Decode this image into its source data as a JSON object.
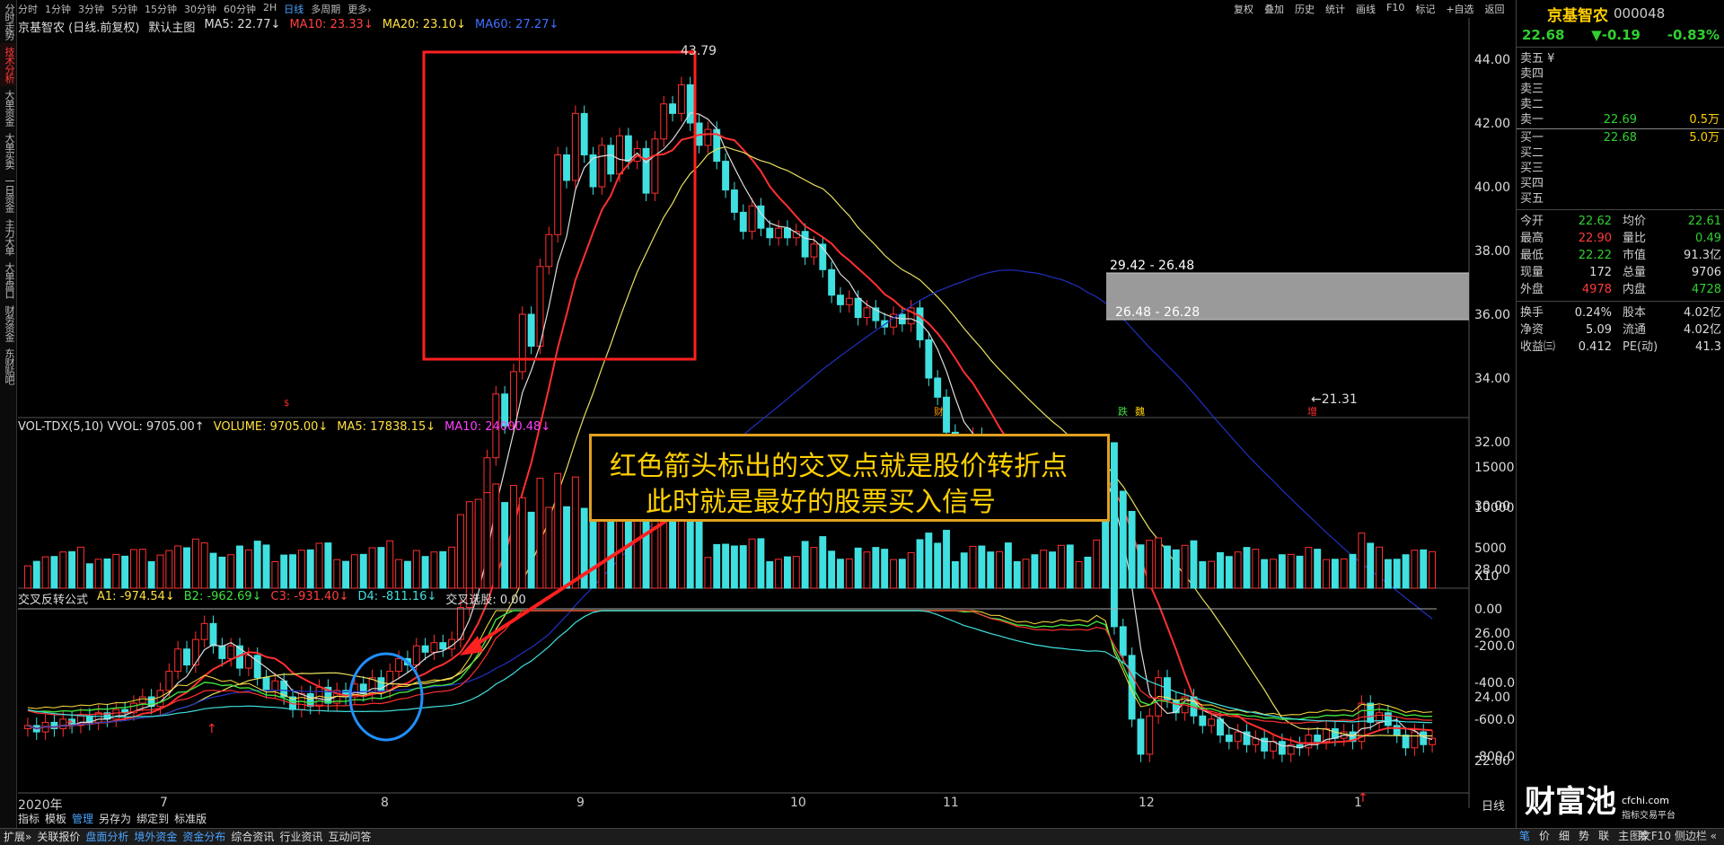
{
  "left_tabs": [
    "分时走势",
    "技术分析",
    "大单资金",
    "大单买卖",
    "一日资金",
    "主力大单",
    "大单盘口",
    "财务资金",
    "东财贴吧"
  ],
  "left_tabs_active": 1,
  "periods": [
    "分时",
    "1分钟",
    "3分钟",
    "5分钟",
    "15分钟",
    "30分钟",
    "60分钟",
    "2H",
    "日线",
    "多周期",
    "更多›"
  ],
  "periods_active": 8,
  "toolbar": [
    "复权",
    "叠加",
    "历史",
    "统计",
    "画线",
    "F10",
    "标记",
    "+自选",
    "返回"
  ],
  "main_legend": {
    "title": "京基智农 (日线.前复权)",
    "main_icon": "默认主图",
    "ma5": "MA5: 22.77↓",
    "ma10": "MA10: 23.33↓",
    "ma20": "MA20: 23.10↓",
    "ma60": "MA60: 27.27↓"
  },
  "vol_legend": {
    "title": "VOL-TDX(5,10) VVOL: 9705.00↑",
    "volume": "VOLUME: 9705.00↓",
    "ma5": "MA5: 17838.15↓",
    "ma10": "MA10: 24000.48↓"
  },
  "ind_legend": {
    "title": "交叉反转公式",
    "a1": "A1: -974.54↓",
    "b2": "B2: -962.69↓",
    "c3": "C3: -931.40↓",
    "d4": "D4: -811.16↓",
    "sel": "交叉选股: 0.00"
  },
  "price_axis": [
    "44.00",
    "42.00",
    "40.00",
    "38.00",
    "36.00",
    "34.00",
    "32.00",
    "30.00",
    "28.00",
    "26.00",
    "24.00",
    "22.00"
  ],
  "vol_axis": [
    "15000",
    "10000",
    "5000",
    "X10"
  ],
  "ind_axis": [
    "0.00",
    "-200.0",
    "-400.0",
    "-600.0",
    "-800.0"
  ],
  "x_labels": [
    "2020年",
    "7",
    "8",
    "9",
    "10",
    "11",
    "12",
    "1"
  ],
  "day_label": "日线",
  "chart_annotations": {
    "high": "43.79",
    "low": "←21.31",
    "gap_upper": "29.42 - 26.48",
    "gap_lower": "26.48 - 26.28",
    "events": [
      "财",
      "跌",
      "魏",
      "增",
      "$"
    ]
  },
  "note": {
    "line1": "红色箭头标出的交叉点就是股价转折点",
    "line2": "此时就是最好的股票买入信号"
  },
  "quote": {
    "name": "京基智农",
    "code": "000048",
    "price": "22.68",
    "change": "▼-0.19",
    "pct": "-0.83%",
    "asks": [
      {
        "label": "卖五 ¥",
        "price": "",
        "size": ""
      },
      {
        "label": "卖四",
        "price": "",
        "size": ""
      },
      {
        "label": "卖三",
        "price": "",
        "size": ""
      },
      {
        "label": "卖二",
        "price": "",
        "size": ""
      },
      {
        "label": "卖一",
        "price": "22.69",
        "size": "0.5万"
      }
    ],
    "bids": [
      {
        "label": "买一",
        "price": "22.68",
        "size": "5.0万"
      },
      {
        "label": "买二",
        "price": "",
        "size": ""
      },
      {
        "label": "买三",
        "price": "",
        "size": ""
      },
      {
        "label": "买四",
        "price": "",
        "size": ""
      },
      {
        "label": "买五",
        "price": "",
        "size": ""
      }
    ],
    "stats": [
      {
        "l1": "今开",
        "v1": "22.62",
        "c1": "g",
        "l2": "均价",
        "v2": "22.61",
        "c2": "g"
      },
      {
        "l1": "最高",
        "v1": "22.90",
        "c1": "r",
        "l2": "量比",
        "v2": "0.49",
        "c2": "g"
      },
      {
        "l1": "最低",
        "v1": "22.22",
        "c1": "g",
        "l2": "市值",
        "v2": "91.3亿",
        "c2": "w"
      },
      {
        "l1": "现量",
        "v1": "172",
        "c1": "w",
        "l2": "总量",
        "v2": "9706",
        "c2": "w"
      },
      {
        "l1": "外盘",
        "v1": "4978",
        "c1": "r",
        "l2": "内盘",
        "v2": "4728",
        "c2": "g"
      }
    ],
    "stats2": [
      {
        "l1": "换手",
        "v1": "0.24%",
        "c1": "w",
        "l2": "股本",
        "v2": "4.02亿",
        "c2": "w"
      },
      {
        "l1": "净资",
        "v1": "5.09",
        "c1": "w",
        "l2": "流通",
        "v2": "4.02亿",
        "c2": "w"
      },
      {
        "l1": "收益㈢",
        "v1": "0.412",
        "c1": "w",
        "l2": "PE(动)",
        "v2": "41.3",
        "c2": "w"
      }
    ]
  },
  "brand": {
    "big": "财富池",
    "site": "cfchi.com",
    "sub": "指标交易平台"
  },
  "bottom_tabs": [
    "指标",
    "模板",
    "管理",
    "另存为",
    "绑定到",
    "标准版"
  ],
  "bottom_tabs_active": 2,
  "status": [
    "扩展»",
    "关联报价",
    "盘面分析",
    "境外资金",
    "资金分布",
    "综合资讯",
    "行业资讯",
    "互动问答"
  ],
  "status_right": "图文F10 侧边栏 «",
  "right_letters": [
    "笔",
    "价",
    "细",
    "势",
    "联",
    "主",
    "筹"
  ],
  "colors": {
    "ma5": "#dddddd",
    "ma10": "#ff3030",
    "ma20": "#e8e060",
    "ma60": "#2030c0",
    "up": "#ff3030",
    "down": "#40e0e0",
    "box": "#ff2020",
    "circle": "#2090ff"
  },
  "chart_data": {
    "type": "candlestick",
    "candles": [
      [
        23.0,
        23.1
      ],
      [
        23.1,
        22.9
      ],
      [
        22.9,
        23.2
      ],
      [
        23.2,
        23.0
      ],
      [
        23.0,
        23.3
      ],
      [
        23.3,
        23.1
      ],
      [
        23.1,
        23.4
      ],
      [
        23.4,
        23.2
      ],
      [
        23.2,
        23.5
      ],
      [
        23.5,
        23.3
      ],
      [
        23.3,
        23.6
      ],
      [
        23.6,
        23.5
      ],
      [
        23.5,
        23.8
      ],
      [
        23.8,
        24.0
      ],
      [
        24.0,
        23.7
      ],
      [
        23.7,
        24.2
      ],
      [
        24.2,
        24.8
      ],
      [
        24.8,
        25.5
      ],
      [
        25.5,
        25.0
      ],
      [
        25.0,
        25.8
      ],
      [
        25.8,
        26.3
      ],
      [
        26.3,
        25.6
      ],
      [
        25.6,
        25.2
      ],
      [
        25.2,
        25.6
      ],
      [
        25.6,
        24.9
      ],
      [
        24.9,
        25.3
      ],
      [
        25.3,
        24.6
      ],
      [
        24.6,
        24.2
      ],
      [
        24.2,
        24.5
      ],
      [
        24.5,
        24.0
      ],
      [
        24.0,
        23.6
      ],
      [
        23.6,
        24.1
      ],
      [
        24.1,
        23.7
      ],
      [
        23.7,
        24.3
      ],
      [
        24.3,
        23.8
      ],
      [
        23.8,
        24.2
      ],
      [
        24.2,
        24.0
      ],
      [
        24.0,
        24.4
      ],
      [
        24.4,
        24.1
      ],
      [
        24.1,
        24.6
      ],
      [
        24.6,
        24.2
      ],
      [
        24.2,
        24.8
      ],
      [
        24.8,
        25.2
      ],
      [
        25.2,
        25.0
      ],
      [
        25.0,
        25.6
      ],
      [
        25.6,
        25.4
      ],
      [
        25.4,
        25.7
      ],
      [
        25.7,
        25.5
      ],
      [
        25.5,
        25.8
      ],
      [
        25.8,
        26.8
      ],
      [
        26.8,
        28.3
      ],
      [
        28.3,
        29.8
      ],
      [
        29.8,
        31.5
      ],
      [
        31.5,
        33.5
      ],
      [
        33.5,
        32.5
      ],
      [
        32.5,
        34.2
      ],
      [
        34.2,
        36.0
      ],
      [
        36.0,
        35.0
      ],
      [
        35.0,
        37.5
      ],
      [
        37.5,
        38.5
      ],
      [
        38.5,
        41.0
      ],
      [
        41.0,
        40.2
      ],
      [
        40.2,
        42.3
      ],
      [
        42.3,
        41.0
      ],
      [
        41.0,
        40.0
      ],
      [
        40.0,
        41.3
      ],
      [
        41.3,
        40.4
      ],
      [
        40.4,
        41.6
      ],
      [
        41.6,
        40.8
      ],
      [
        40.8,
        41.2
      ],
      [
        41.2,
        39.8
      ],
      [
        39.8,
        41.5
      ],
      [
        41.5,
        42.6
      ],
      [
        42.6,
        42.3
      ],
      [
        42.3,
        43.2
      ],
      [
        43.2,
        42.0
      ],
      [
        42.0,
        41.3
      ],
      [
        41.3,
        41.8
      ],
      [
        41.8,
        40.8
      ],
      [
        40.8,
        39.9
      ],
      [
        39.9,
        39.2
      ],
      [
        39.2,
        38.6
      ],
      [
        38.6,
        39.4
      ],
      [
        39.4,
        38.7
      ],
      [
        38.7,
        38.4
      ],
      [
        38.4,
        38.7
      ],
      [
        38.7,
        38.4
      ],
      [
        38.4,
        38.6
      ],
      [
        38.6,
        37.8
      ],
      [
        37.8,
        38.2
      ],
      [
        38.2,
        37.4
      ],
      [
        37.4,
        36.6
      ],
      [
        36.6,
        36.3
      ],
      [
        36.3,
        36.5
      ],
      [
        36.5,
        35.9
      ],
      [
        35.9,
        36.2
      ],
      [
        36.2,
        35.8
      ],
      [
        35.8,
        35.6
      ],
      [
        35.6,
        36.0
      ],
      [
        36.0,
        35.7
      ],
      [
        35.7,
        36.2
      ],
      [
        36.2,
        35.2
      ],
      [
        35.2,
        34.0
      ],
      [
        34.0,
        33.4
      ],
      [
        33.4,
        32.3
      ],
      [
        32.3,
        32.0
      ],
      [
        32.0,
        31.4
      ],
      [
        31.4,
        32.2
      ],
      [
        32.2,
        31.5
      ],
      [
        31.5,
        31.2
      ],
      [
        31.2,
        31.4
      ],
      [
        31.4,
        30.9
      ],
      [
        30.9,
        30.6
      ],
      [
        30.6,
        30.9
      ],
      [
        30.9,
        30.5
      ],
      [
        30.5,
        31.0
      ],
      [
        31.0,
        30.7
      ],
      [
        30.7,
        31.2
      ],
      [
        31.2,
        30.8
      ],
      [
        30.8,
        31.1
      ],
      [
        31.1,
        30.7
      ],
      [
        30.7,
        31.8
      ],
      [
        31.8,
        30.6
      ],
      [
        30.6,
        26.2
      ],
      [
        26.2,
        25.3
      ],
      [
        25.3,
        23.3
      ],
      [
        23.3,
        22.2
      ],
      [
        22.2,
        23.4
      ],
      [
        23.4,
        24.6
      ],
      [
        24.6,
        23.9
      ],
      [
        23.9,
        23.5
      ],
      [
        23.5,
        24.0
      ],
      [
        24.0,
        23.4
      ],
      [
        23.4,
        23.1
      ],
      [
        23.1,
        23.3
      ],
      [
        23.3,
        22.8
      ],
      [
        22.8,
        22.6
      ],
      [
        22.6,
        22.9
      ],
      [
        22.9,
        22.5
      ],
      [
        22.5,
        22.7
      ],
      [
        22.7,
        22.3
      ],
      [
        22.3,
        22.6
      ],
      [
        22.6,
        22.2
      ],
      [
        22.2,
        22.5
      ],
      [
        22.5,
        22.4
      ],
      [
        22.4,
        22.8
      ],
      [
        22.8,
        22.6
      ],
      [
        22.6,
        23.0
      ],
      [
        23.0,
        22.7
      ],
      [
        22.7,
        22.9
      ],
      [
        22.9,
        22.6
      ],
      [
        22.6,
        23.8
      ],
      [
        23.8,
        23.2
      ],
      [
        23.2,
        23.5
      ],
      [
        23.5,
        23.1
      ],
      [
        23.1,
        22.8
      ],
      [
        22.8,
        22.4
      ],
      [
        22.4,
        22.9
      ],
      [
        22.9,
        22.5
      ],
      [
        22.5,
        22.7
      ]
    ],
    "volume_scale_max": 20000,
    "indicator_range": [
      -1000,
      50
    ],
    "x_axis_labels": [
      "2020年",
      "7",
      "8",
      "9",
      "10",
      "11",
      "12",
      "1"
    ]
  }
}
